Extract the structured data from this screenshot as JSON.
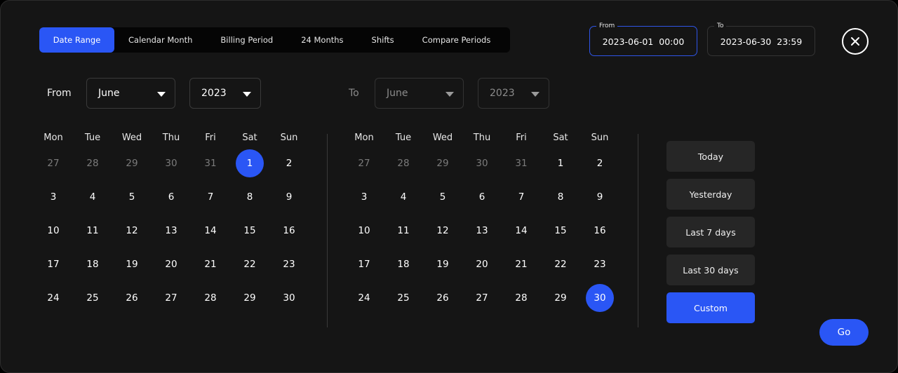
{
  "tabs": [
    "Date Range",
    "Calendar Month",
    "Billing Period",
    "24 Months",
    "Shifts",
    "Compare Periods"
  ],
  "range": {
    "from_label": "From",
    "from_value": "2023-06-01  00:00",
    "to_label": "To",
    "to_value": "2023-06-30  23:59"
  },
  "selectors": {
    "from_label": "From",
    "from_month": "June",
    "from_year": "2023",
    "to_label": "To",
    "to_month": "June",
    "to_year": "2023"
  },
  "weekdays": [
    "Mon",
    "Tue",
    "Wed",
    "Thu",
    "Fri",
    "Sat",
    "Sun"
  ],
  "calendar_left": {
    "weeks": [
      [
        {
          "d": "27",
          "m": true
        },
        {
          "d": "28",
          "m": true
        },
        {
          "d": "29",
          "m": true
        },
        {
          "d": "30",
          "m": true
        },
        {
          "d": "31",
          "m": true
        },
        {
          "d": "1",
          "s": true
        },
        {
          "d": "2"
        }
      ],
      [
        {
          "d": "3"
        },
        {
          "d": "4"
        },
        {
          "d": "5"
        },
        {
          "d": "6"
        },
        {
          "d": "7"
        },
        {
          "d": "8"
        },
        {
          "d": "9"
        }
      ],
      [
        {
          "d": "10"
        },
        {
          "d": "11"
        },
        {
          "d": "12"
        },
        {
          "d": "13"
        },
        {
          "d": "14"
        },
        {
          "d": "15"
        },
        {
          "d": "16"
        }
      ],
      [
        {
          "d": "17"
        },
        {
          "d": "18"
        },
        {
          "d": "19"
        },
        {
          "d": "20"
        },
        {
          "d": "21"
        },
        {
          "d": "22"
        },
        {
          "d": "23"
        }
      ],
      [
        {
          "d": "24"
        },
        {
          "d": "25"
        },
        {
          "d": "26"
        },
        {
          "d": "27"
        },
        {
          "d": "28"
        },
        {
          "d": "29"
        },
        {
          "d": "30"
        }
      ]
    ]
  },
  "calendar_right": {
    "weeks": [
      [
        {
          "d": "27",
          "m": true
        },
        {
          "d": "28",
          "m": true
        },
        {
          "d": "29",
          "m": true
        },
        {
          "d": "30",
          "m": true
        },
        {
          "d": "31",
          "m": true
        },
        {
          "d": "1"
        },
        {
          "d": "2"
        }
      ],
      [
        {
          "d": "3"
        },
        {
          "d": "4"
        },
        {
          "d": "5"
        },
        {
          "d": "6"
        },
        {
          "d": "7"
        },
        {
          "d": "8"
        },
        {
          "d": "9"
        }
      ],
      [
        {
          "d": "10"
        },
        {
          "d": "11"
        },
        {
          "d": "12"
        },
        {
          "d": "13"
        },
        {
          "d": "14"
        },
        {
          "d": "15"
        },
        {
          "d": "16"
        }
      ],
      [
        {
          "d": "17"
        },
        {
          "d": "18"
        },
        {
          "d": "19"
        },
        {
          "d": "20"
        },
        {
          "d": "21"
        },
        {
          "d": "22"
        },
        {
          "d": "23"
        }
      ],
      [
        {
          "d": "24"
        },
        {
          "d": "25"
        },
        {
          "d": "26"
        },
        {
          "d": "27"
        },
        {
          "d": "28"
        },
        {
          "d": "29"
        },
        {
          "d": "30",
          "s": true
        }
      ]
    ]
  },
  "presets": [
    "Today",
    "Yesterday",
    "Last 7 days",
    "Last 30 days",
    "Custom"
  ],
  "active_preset": "Custom",
  "go_label": "Go",
  "colors": {
    "accent": "#2a56f5",
    "background": "#151515"
  },
  "icons": {
    "close": "close-icon",
    "dropdown": "chevron-down-icon"
  }
}
